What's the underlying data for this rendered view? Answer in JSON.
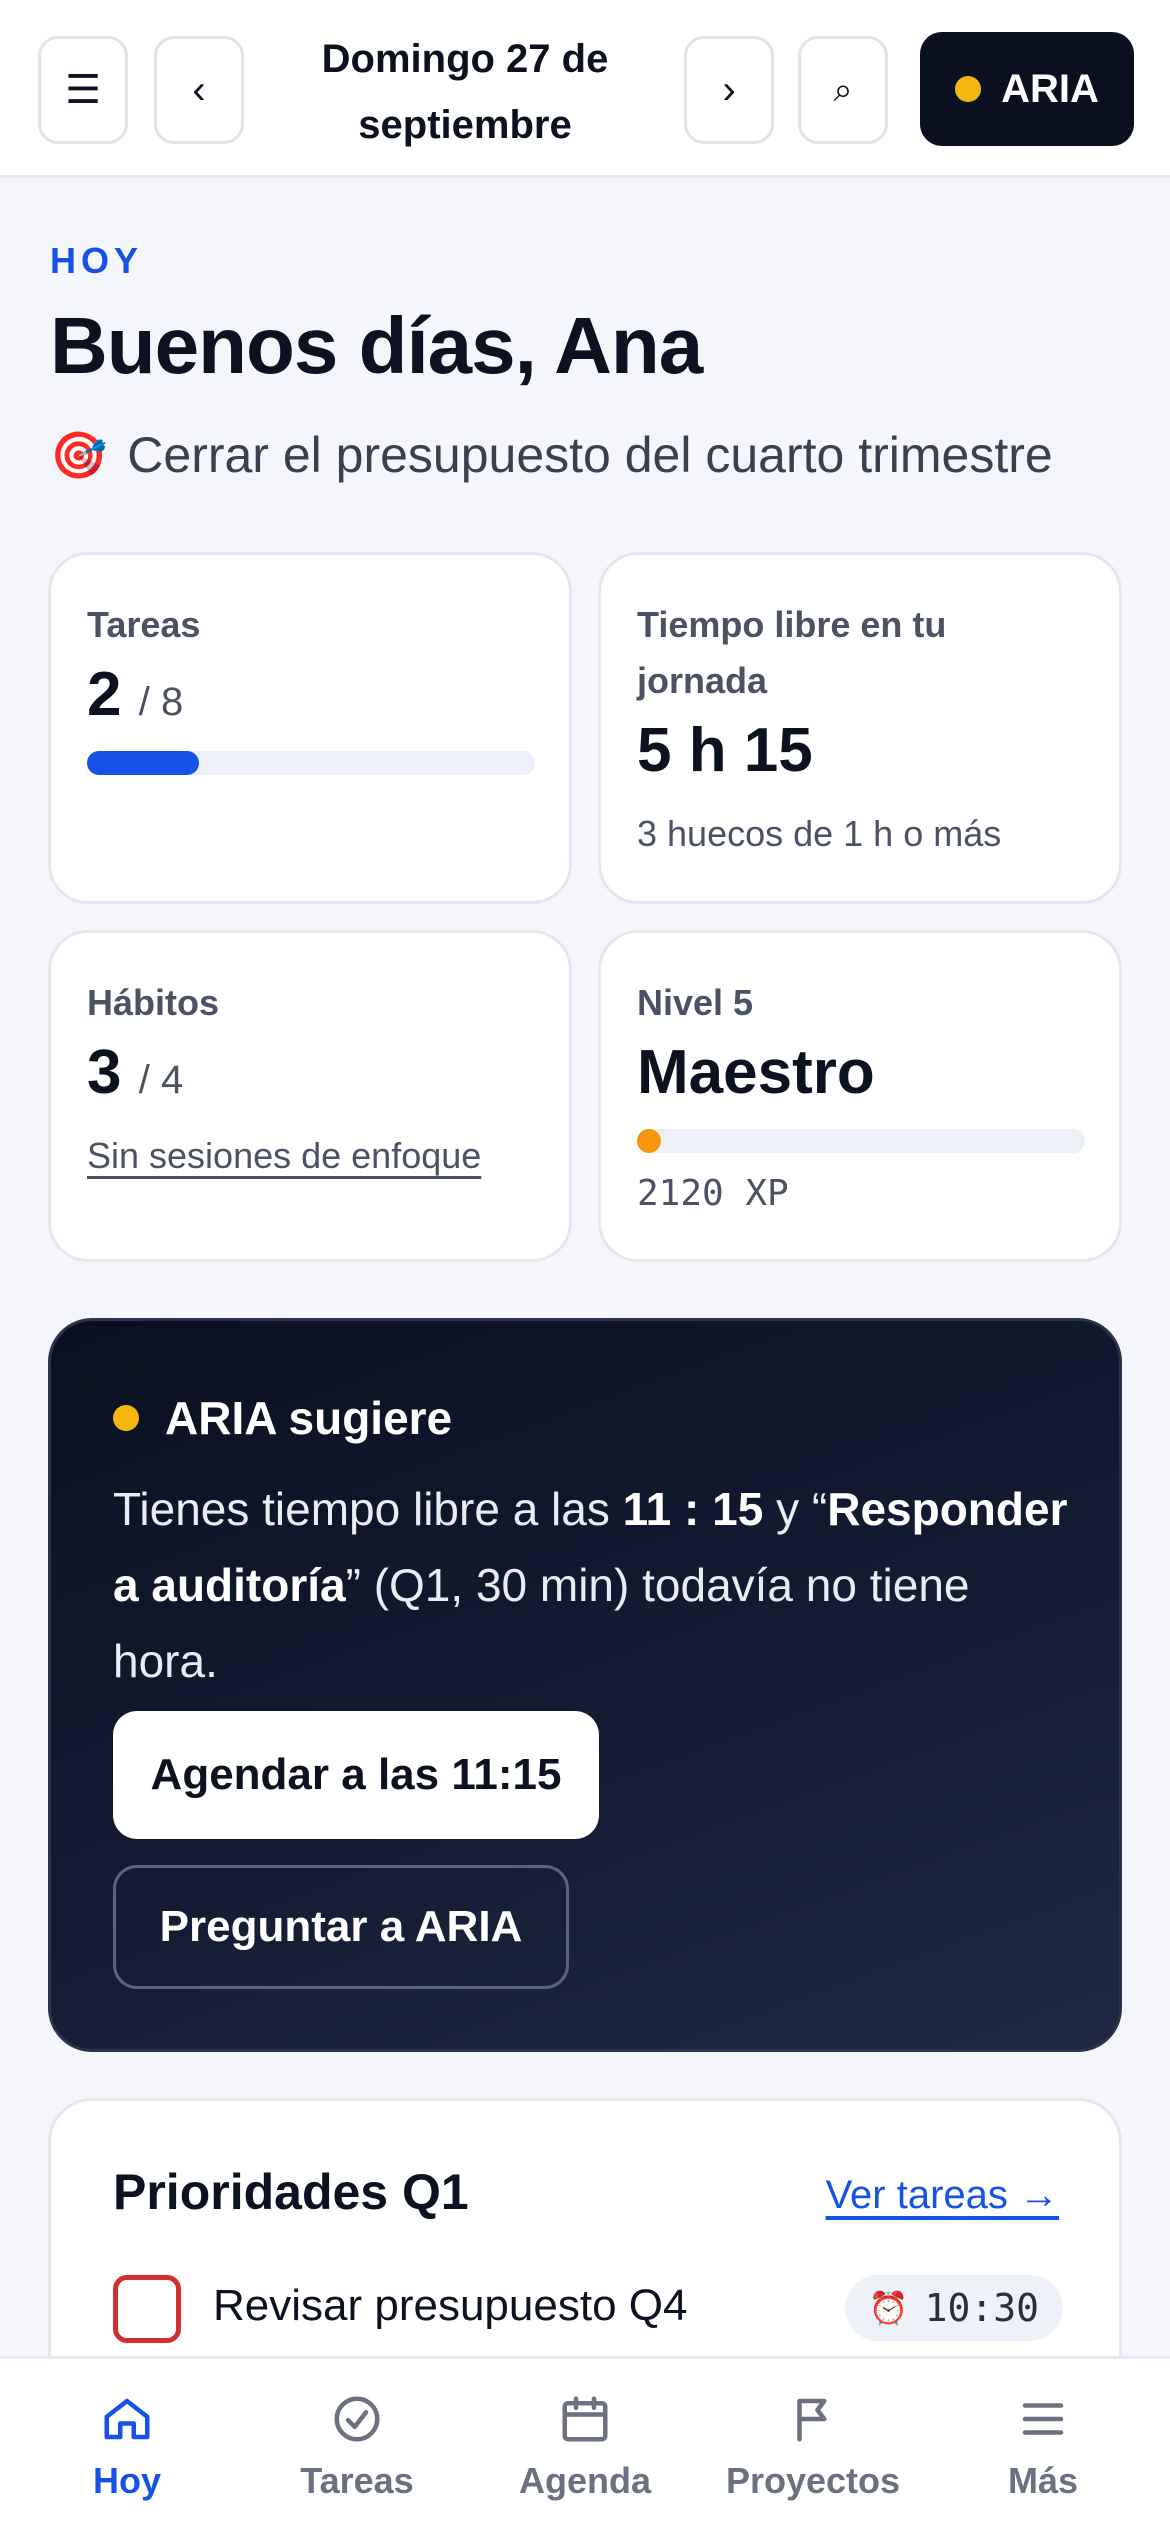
{
  "header": {
    "date_line1": "Domingo 27 de",
    "date_line2": "septiembre",
    "menu_icon": "☰",
    "prev_icon": "‹",
    "next_icon": "›",
    "search_icon": "⌕",
    "aria_label": "ARIA"
  },
  "hero": {
    "kicker": "HOY",
    "greeting": "Buenos días, Ana",
    "goal_icon": "🎯",
    "goal": "Cerrar el presupuesto del cuarto trimestre"
  },
  "cards": {
    "tasks": {
      "label": "Tareas",
      "done": "2",
      "total": "/ 8",
      "progress": 0.25
    },
    "free_time": {
      "label_line1": "Tiempo libre en tu",
      "label_line2": "jornada",
      "value": "5 h 15",
      "sub": "3 huecos de 1 h o más"
    },
    "habits": {
      "label": "Hábitos",
      "done": "3",
      "total": "/ 4",
      "link": "Sin sesiones de enfoque"
    },
    "level": {
      "label": "Nivel 5",
      "title": "Maestro",
      "xp": "2120 XP",
      "progress": 0.03
    }
  },
  "suggestion": {
    "title": "ARIA sugiere",
    "text_prefix": "Tienes tiempo libre a las ",
    "time": "11 : 15",
    "text_mid": " y “",
    "task": "Responder a auditoría",
    "text_suffix": "” (Q1, 30 min) todavía no tiene hora.",
    "primary_button": "Agendar a las 11:15",
    "secondary_button": "Preguntar a ARIA"
  },
  "priorities": {
    "title": "Prioridades Q1",
    "link": "Ver tareas →",
    "items": [
      {
        "name": "Revisar presupuesto Q4",
        "alarm_icon": "⏰",
        "time": "10:30"
      }
    ]
  },
  "nav": {
    "items": [
      {
        "label": "Hoy",
        "icon": "home-icon"
      },
      {
        "label": "Tareas",
        "icon": "check-circle-icon"
      },
      {
        "label": "Agenda",
        "icon": "calendar-icon"
      },
      {
        "label": "Proyectos",
        "icon": "flag-icon"
      },
      {
        "label": "Más",
        "icon": "menu-icon"
      }
    ]
  },
  "colors": {
    "accent": "#1652e8",
    "aria_dot": "#f5b60f",
    "level_fill": "#f5960f",
    "priority_red": "#d22f2f"
  }
}
